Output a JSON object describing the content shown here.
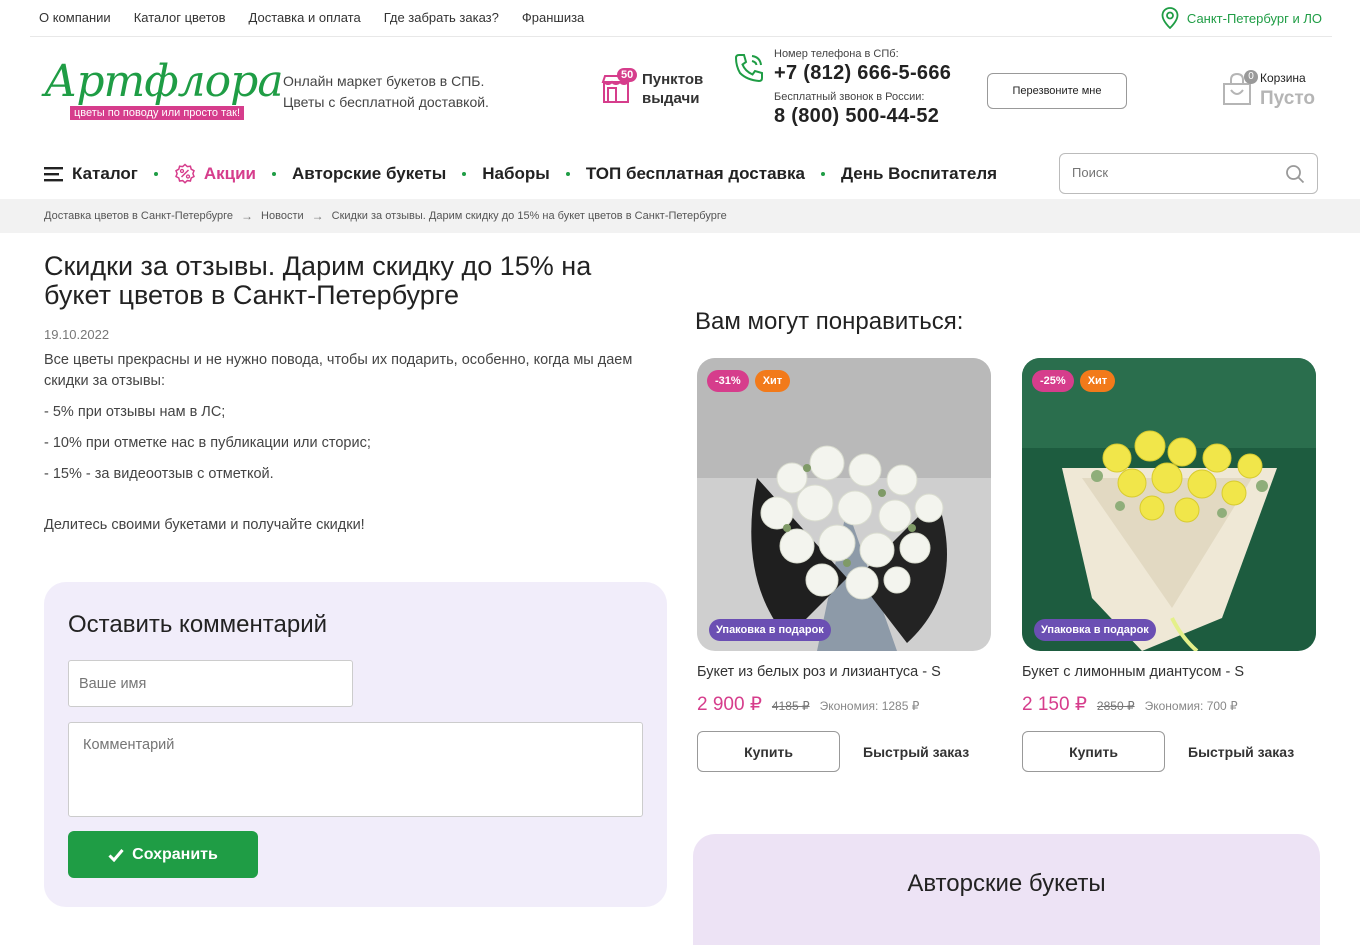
{
  "topbar": {
    "links": [
      "О компании",
      "Каталог цветов",
      "Доставка и оплата",
      "Где забрать заказ?",
      "Франшиза"
    ],
    "city": "Санкт-Петербург и ЛО"
  },
  "header": {
    "logo_text": "Артфлора",
    "logo_tagline": "цветы по поводу или просто так!",
    "tagline_line1": "Онлайн маркет букетов в СПБ.",
    "tagline_line2": "Цветы с бесплатной доставкой.",
    "pickup_count": "50",
    "pickup_line1": "Пунктов",
    "pickup_line2": "выдачи",
    "phone_caption": "Номер телефона в СПб:",
    "phone_spb": "+7 (812) 666-5-666",
    "free_caption": "Бесплатный звонок в России:",
    "phone_free": "8 (800) 500-44-52",
    "callback_label": "Перезвоните мне",
    "cart_label": "Корзина",
    "cart_count": "0",
    "cart_status": "Пусто"
  },
  "nav": {
    "catalog": "Каталог",
    "promo": "Акции",
    "author": "Авторские букеты",
    "sets": "Наборы",
    "top": "ТОП бесплатная доставка",
    "day": "День Воспитателя",
    "search_placeholder": "Поиск"
  },
  "breadcrumb": [
    "Доставка цветов в Санкт-Петербурге",
    "Новости",
    "Скидки за отзывы. Дарим скидку до 15% на букет цветов в Санкт-Петербурге"
  ],
  "article": {
    "title": "Скидки за отзывы. Дарим скидку до 15% на букет цветов в Санкт-Петербурге",
    "date": "19.10.2022",
    "intro": "Все цветы прекрасны и не нужно повода, чтобы их подарить, особенно, когда мы даем скидки за отзывы:",
    "item1": "- 5% при отзывы нам в ЛС;",
    "item2": "- 10% при отметке нас в публикации или сторис;",
    "item3": "- 15% - за видеоотзыв с отметкой.",
    "outro": "Делитесь своими букетами и получайте скидки!"
  },
  "comment": {
    "title": "Оставить комментарий",
    "name_placeholder": "Ваше имя",
    "comment_placeholder": "Комментарий",
    "save_label": "Сохранить"
  },
  "recommend": {
    "title": "Вам могут понравиться:",
    "cards": [
      {
        "sale": "-31%",
        "hit": "Хит",
        "gift": "Упаковка в подарок",
        "name": "Букет из белых роз и лизиантуса - S",
        "price": "2 900 ₽",
        "old": "4185 ₽",
        "saving": "Экономия: 1285 ₽",
        "buy": "Купить",
        "quick": "Быстрый заказ"
      },
      {
        "sale": "-25%",
        "hit": "Хит",
        "gift": "Упаковка в подарок",
        "name": "Букет с лимонным диантусом - S",
        "price": "2 150 ₽",
        "old": "2850 ₽",
        "saving": "Экономия: 700 ₽",
        "buy": "Купить",
        "quick": "Быстрый заказ"
      }
    ]
  },
  "author_section": {
    "title": "Авторские букеты"
  },
  "colors": {
    "brand_green": "#1f9d45",
    "accent_pink": "#d63d8c",
    "hit_orange": "#f27a1a",
    "gift_purple": "#6b4fb3"
  },
  "icons": [
    "location-pin-icon",
    "pickup-shop-icon",
    "phone-icon",
    "cart-icon",
    "menu-icon",
    "percent-icon",
    "search-icon",
    "check-icon",
    "arrow-right-icon"
  ]
}
